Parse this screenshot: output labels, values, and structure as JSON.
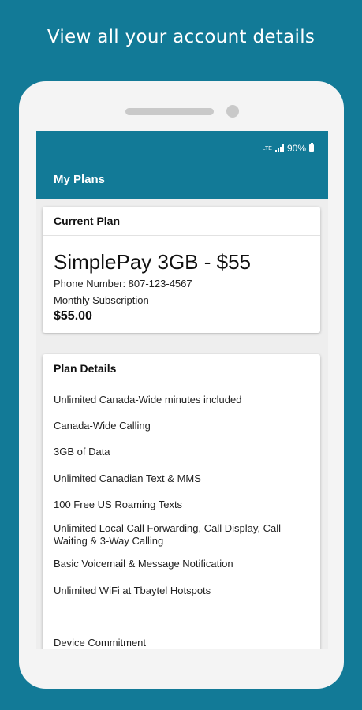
{
  "headline": "View all your account details",
  "status_bar": {
    "network": "LTE",
    "battery": "90%"
  },
  "app_bar": {
    "title": "My Plans"
  },
  "current_plan": {
    "header": "Current Plan",
    "plan_name": "SimplePay 3GB - $55",
    "phone_number_line": "Phone Number: 807-123-4567",
    "subscription_label": "Monthly Subscription",
    "price": "$55.00"
  },
  "plan_details": {
    "header": "Plan Details",
    "items": [
      "Unlimited Canada-Wide minutes included",
      "Canada-Wide Calling",
      "3GB of Data",
      "Unlimited Canadian Text & MMS",
      "100 Free US Roaming Texts",
      "Unlimited Local Call Forwarding, Call Display, Call Waiting & 3-Way Calling",
      "Basic Voicemail & Message Notification",
      "Unlimited WiFi at Tbaytel Hotspots"
    ],
    "device_commitment_label": "Device Commitment"
  },
  "colors": {
    "brand": "#127a97",
    "background": "#eeeeee"
  }
}
